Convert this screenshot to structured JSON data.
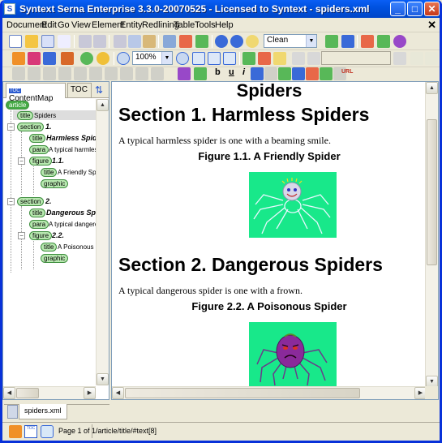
{
  "window": {
    "title": "Syntext Serna Enterprise 3.3.0-20070525 - Licensed to Syntext - spiders.xml",
    "app_icon": "syntext-app-icon",
    "min_label": "_",
    "max_label": "□",
    "close_label": "✕"
  },
  "menu": {
    "items": [
      "Document",
      "Edit",
      "Go",
      "View",
      "Element",
      "Entity",
      "Redlining",
      "Table",
      "Tools",
      "Help"
    ],
    "close": "✕"
  },
  "toolbar": {
    "style_select": "Clean",
    "zoom_select": "100%"
  },
  "format_buttons": {
    "bold": "b",
    "underline": "u",
    "italic": "i",
    "url": "URL"
  },
  "left_panel": {
    "tabs": [
      "ContentMap",
      "TOC"
    ],
    "tree": [
      {
        "tag": "article",
        "text": ""
      },
      {
        "tag": "title",
        "text": "Spiders"
      },
      {
        "tag": "section",
        "text": "1."
      },
      {
        "tag": "title",
        "text": "Harmless Spiders"
      },
      {
        "tag": "para",
        "text": "A typical harmless spic"
      },
      {
        "tag": "figure",
        "text": "1.1."
      },
      {
        "tag": "title",
        "text": "A Friendly Spider"
      },
      {
        "tag": "graphic",
        "text": ""
      },
      {
        "tag": "section",
        "text": "2."
      },
      {
        "tag": "title",
        "text": "Dangerous Spiders"
      },
      {
        "tag": "para",
        "text": "A typical dangerous sp"
      },
      {
        "tag": "figure",
        "text": "2.2."
      },
      {
        "tag": "title",
        "text": "A Poisonous Spide"
      },
      {
        "tag": "graphic",
        "text": ""
      }
    ]
  },
  "document": {
    "title": "Spiders",
    "sections": [
      {
        "heading": "Section 1. Harmless Spiders",
        "para": "A typical harmless spider is one with a beaming smile.",
        "figure_title": "Figure 1.1. A Friendly Spider",
        "figure_bg": "#18e88a"
      },
      {
        "heading": "Section 2. Dangerous Spiders",
        "para": "A typical dangerous spider is one with a frown.",
        "figure_title": "Figure 2.2. A Poisonous Spider",
        "figure_bg": "#18e88a"
      }
    ]
  },
  "doc_tab": {
    "label": "spiders.xml"
  },
  "status": {
    "page": "Page 1 of 1",
    "path": "/article/title/#text[8]"
  },
  "colors": {
    "titlebar": "#0052e0",
    "figure_bg": "#18e88a",
    "node_bg": "#b8e8b0"
  }
}
